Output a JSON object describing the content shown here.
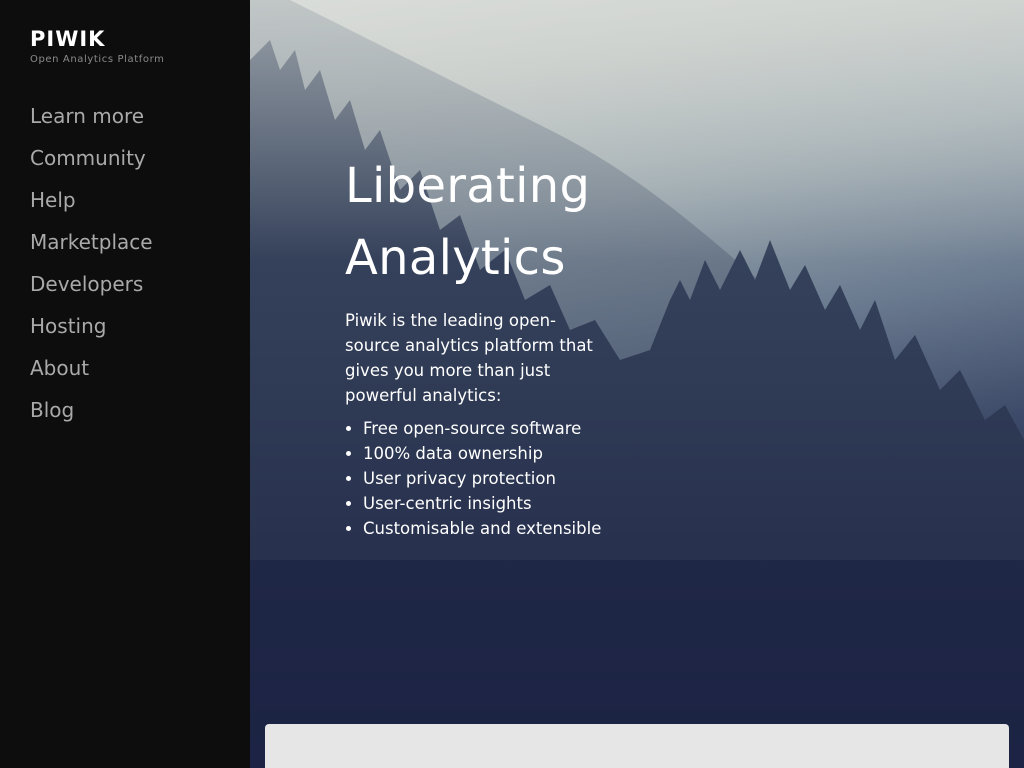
{
  "sidebar": {
    "logo": "PIWIK",
    "tagline": "Open Analytics Platform",
    "nav": [
      {
        "label": "Learn more"
      },
      {
        "label": "Community"
      },
      {
        "label": "Help"
      },
      {
        "label": "Marketplace"
      },
      {
        "label": "Developers"
      },
      {
        "label": "Hosting"
      },
      {
        "label": "About"
      },
      {
        "label": "Blog"
      }
    ]
  },
  "hero": {
    "headline_line1": "Liberating",
    "headline_line2": "Analytics",
    "intro": "Piwik is the leading open-source analytics platform that gives you more than just powerful analytics:",
    "features": [
      "Free open-source software",
      "100% data ownership",
      "User privacy protection",
      "User-centric insights",
      "Customisable and extensible"
    ]
  },
  "colors": {
    "sidebar_bg": "#0d0d0d",
    "nav_text": "#a9a9a9",
    "hero_text": "#ffffff",
    "panel_bg": "#e6e6e6"
  },
  "icons": {
    "background": "misty-forest-image"
  }
}
